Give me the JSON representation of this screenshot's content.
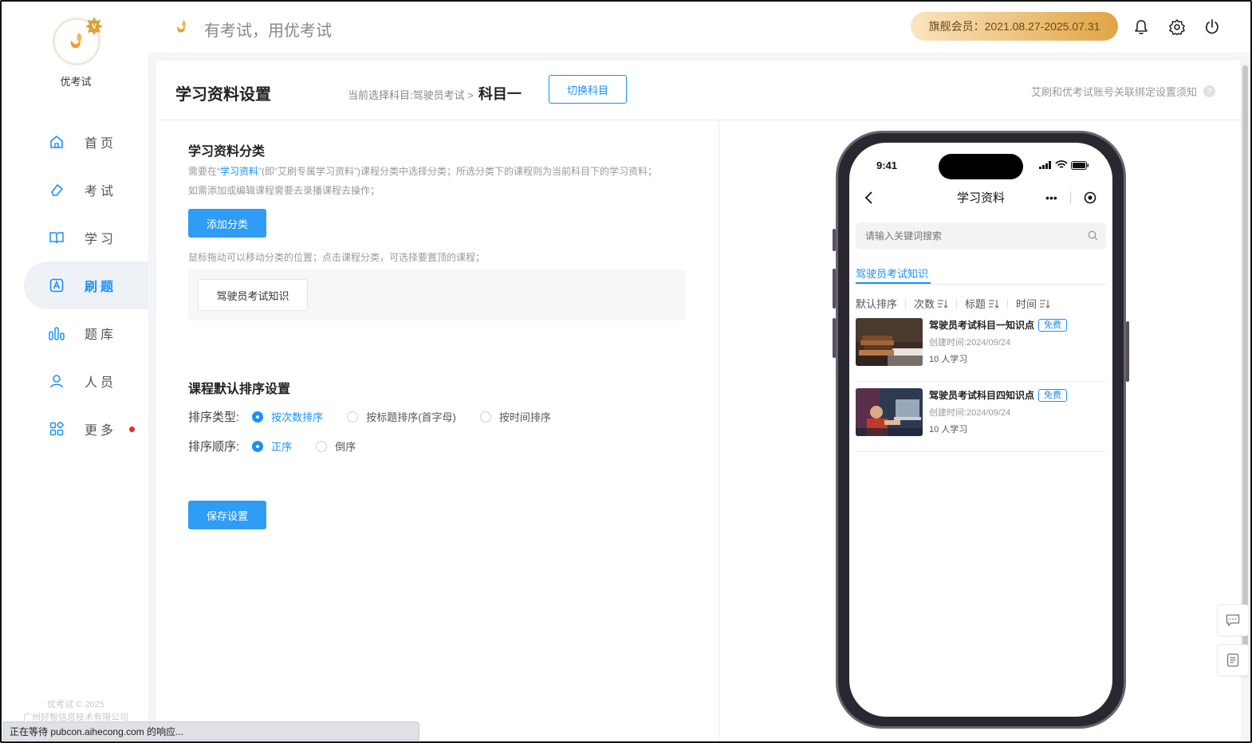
{
  "sidebar": {
    "brand": "优考试",
    "items": [
      {
        "label": "首页",
        "icon": "home-icon"
      },
      {
        "label": "考试",
        "icon": "eraser-icon"
      },
      {
        "label": "学习",
        "icon": "book-icon"
      },
      {
        "label": "刷题",
        "icon": "letter-a-icon",
        "active": true
      },
      {
        "label": "题库",
        "icon": "bar-chart-icon"
      },
      {
        "label": "人员",
        "icon": "user-icon"
      },
      {
        "label": "更多",
        "icon": "apps-icon",
        "dot": true
      }
    ],
    "footer_line1": "优考试 © 2025",
    "footer_line2": "广州好智信息技术有限公司"
  },
  "header": {
    "slogan": "有考试，用优考试",
    "vip": "旗舰会员：2021.08.27-2025.07.31"
  },
  "page": {
    "title": "学习资料设置",
    "crumb_prefix": "当前选择科目:驾驶员考试 >",
    "crumb_current": "科目一",
    "switch_button": "切换科目",
    "bind_note": "艾刷和优考试账号关联绑定设置须知",
    "help": "?"
  },
  "category": {
    "title": "学习资料分类",
    "hint1_pre": "需要在“",
    "hint1_link": "学习资料",
    "hint1_post": "”(即“艾刷专属学习资料”)课程分类中选择分类；所选分类下的课程则为当前科目下的学习资料；",
    "hint2": "如需添加或编辑课程需要去录播课程去操作；",
    "add_button": "添加分类",
    "drag_hint": "鼠标拖动可以移动分类的位置；点击课程分类，可选择要置顶的课程；",
    "items": [
      "驾驶员考试知识"
    ]
  },
  "sort": {
    "title": "课程默认排序设置",
    "type_label": "排序类型:",
    "type_options": [
      "按次数排序",
      "按标题排序(首字母)",
      "按时间排序"
    ],
    "type_selected": 0,
    "order_label": "排序顺序:",
    "order_options": [
      "正序",
      "倒序"
    ],
    "order_selected": 0,
    "save_button": "保存设置"
  },
  "phone": {
    "time": "9:41",
    "title": "学习资料",
    "capsule_more": "•••",
    "search_placeholder": "请输入关键词搜索",
    "tab": "驾驶员考试知识",
    "sorts": [
      "默认排序",
      "次数",
      "标题",
      "时间"
    ],
    "courses": [
      {
        "title": "驾驶员考试科目一知识点",
        "badge": "免费",
        "time": "创建时间:2024/09/24",
        "students": "10 人学习"
      },
      {
        "title": "驾驶员考试科目四知识点",
        "badge": "免费",
        "time": "创建时间:2024/09/24",
        "students": "10 人学习"
      }
    ]
  },
  "browser_status": "正在等待 pubcon.aihecong.com 的响应..."
}
